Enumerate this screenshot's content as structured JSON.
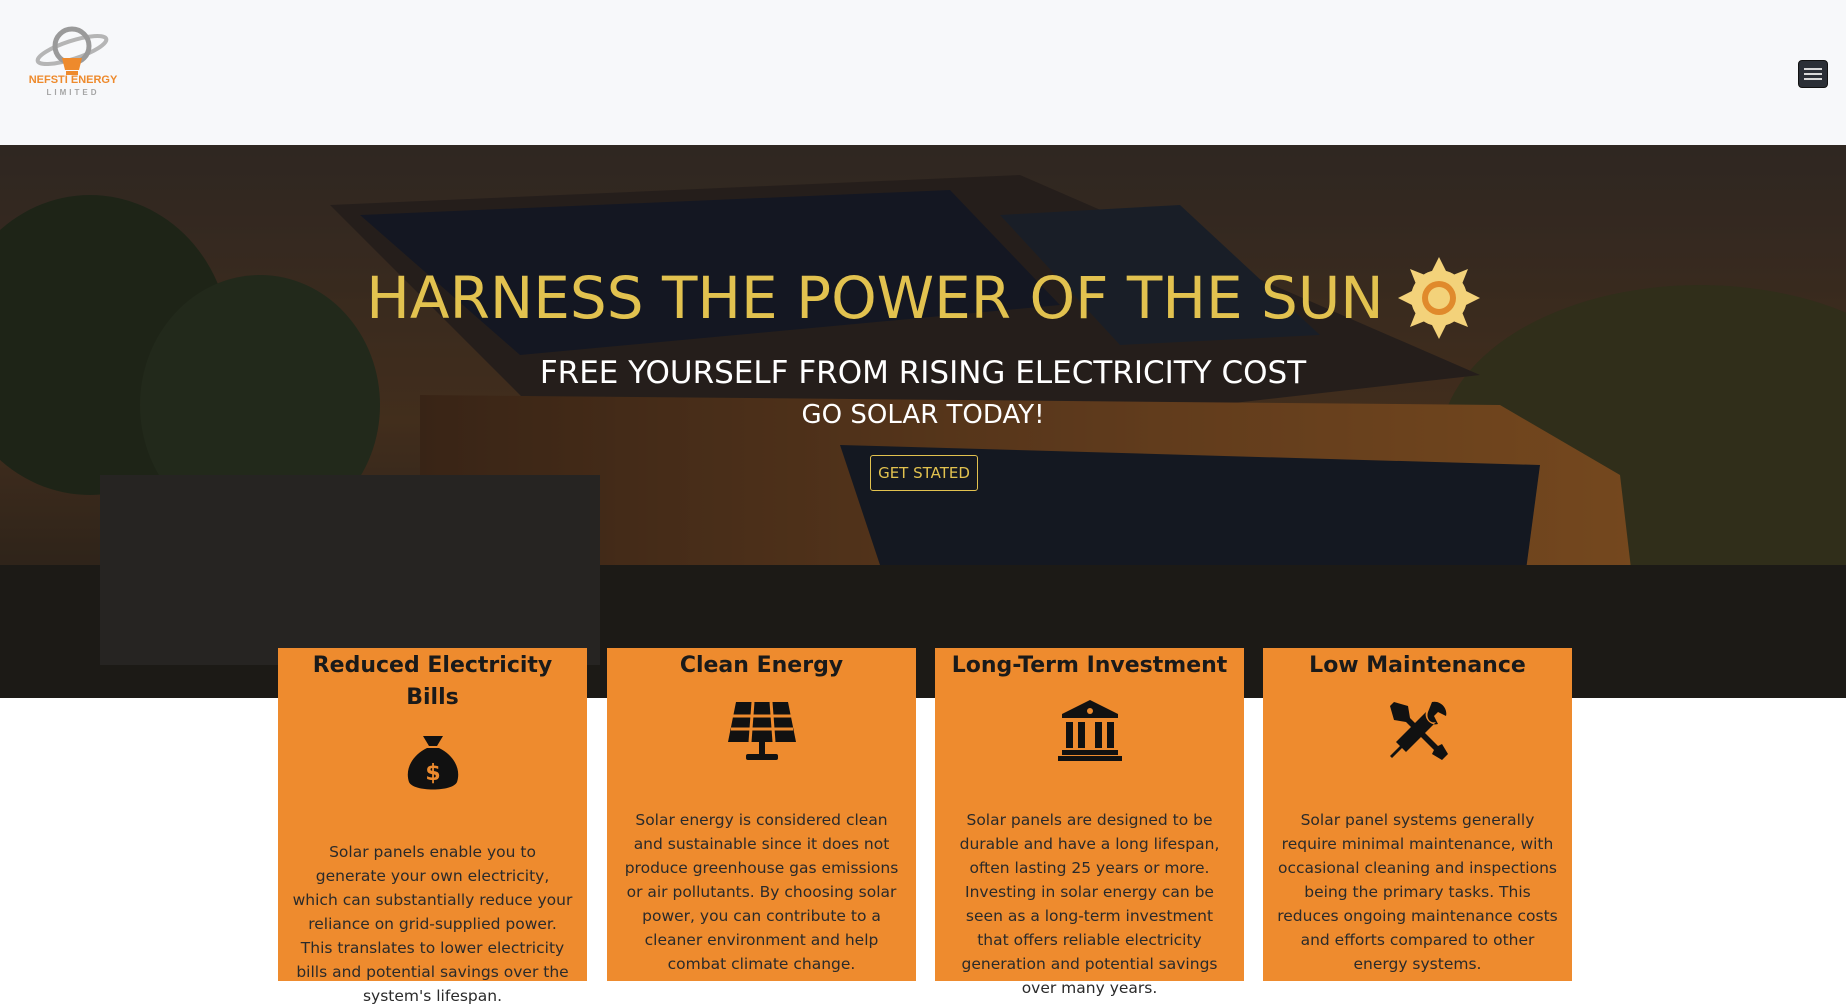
{
  "navbar": {
    "logo_text": "NEFSTI ENERGY",
    "logo_sub": "LIMITED",
    "menu_icon": "hamburger-menu-icon"
  },
  "hero": {
    "title": "HARNESS THE POWER OF THE SUN",
    "title_icon": "sun-icon",
    "subtitle": "FREE YOURSELF FROM RISING ELECTRICITY COST",
    "subtitle2": "GO SOLAR TODAY!",
    "cta_label": "GET STATED",
    "title_color": "#e2c24f"
  },
  "features": [
    {
      "title": "Reduced Electricity Bills",
      "icon": "money-bag-icon",
      "text": "Solar panels enable you to generate your own electricity, which can substantially reduce your reliance on grid-supplied power. This translates to lower electricity bills and potential savings over the system's lifespan."
    },
    {
      "title": "Clean Energy",
      "icon": "solar-panel-icon",
      "text": "Solar energy is considered clean and sustainable since it does not produce greenhouse gas emissions or air pollutants. By choosing solar power, you can contribute to a cleaner environment and help combat climate change."
    },
    {
      "title": "Long-Term Investment",
      "icon": "bank-icon",
      "text": "Solar panels are designed to be durable and have a long lifespan, often lasting 25 years or more. Investing in solar energy can be seen as a long-term investment that offers reliable electricity generation and potential savings over many years."
    },
    {
      "title": "Low Maintenance",
      "icon": "tools-icon",
      "text": "Solar panel systems generally require minimal maintenance, with occasional cleaning and inspections being the primary tasks. This reduces ongoing maintenance costs and efforts compared to other energy systems."
    }
  ],
  "colors": {
    "accent": "#ee8b2e",
    "navbar_bg": "#f7f8fa"
  }
}
